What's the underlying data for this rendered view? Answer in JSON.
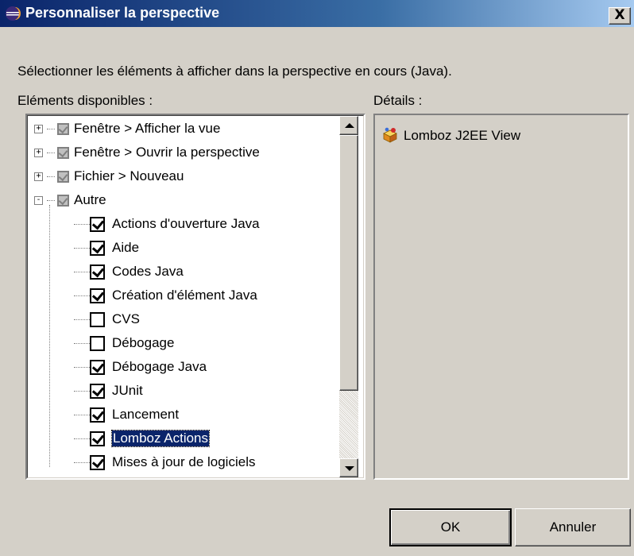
{
  "window": {
    "title": "Personnaliser la perspective",
    "close_label": "X",
    "icon": "eclipse-icon"
  },
  "description": "Sélectionner les éléments à afficher dans la perspective en cours (Java).",
  "labels": {
    "available": "Eléments disponibles :",
    "details": "Détails :"
  },
  "tree": {
    "items": [
      {
        "label": "Fenêtre > Afficher la vue",
        "checked": true,
        "grayed": true,
        "expander": "+",
        "selected": false
      },
      {
        "label": "Fenêtre > Ouvrir la perspective",
        "checked": true,
        "grayed": true,
        "expander": "+",
        "selected": false
      },
      {
        "label": "Fichier > Nouveau",
        "checked": true,
        "grayed": true,
        "expander": "+",
        "selected": false
      },
      {
        "label": "Autre",
        "checked": true,
        "grayed": true,
        "expander": "-",
        "selected": false
      },
      {
        "label": "Actions d'ouverture Java",
        "checked": true,
        "selected": false
      },
      {
        "label": "Aide",
        "checked": true,
        "selected": false
      },
      {
        "label": "Codes Java",
        "checked": true,
        "selected": false
      },
      {
        "label": "Création d'élément Java",
        "checked": true,
        "selected": false
      },
      {
        "label": "CVS",
        "checked": false,
        "selected": false
      },
      {
        "label": "Débogage",
        "checked": false,
        "selected": false
      },
      {
        "label": "Débogage Java",
        "checked": true,
        "selected": false
      },
      {
        "label": "JUnit",
        "checked": true,
        "selected": false
      },
      {
        "label": "Lancement",
        "checked": true,
        "selected": false
      },
      {
        "label": "Lomboz Actions",
        "checked": true,
        "selected": true
      },
      {
        "label": "Mises à jour de logiciels",
        "checked": true,
        "selected": false
      }
    ]
  },
  "details": {
    "items": [
      {
        "label": "Lomboz J2EE View",
        "icon": "lomboz-view-icon"
      }
    ]
  },
  "buttons": {
    "ok": "OK",
    "cancel": "Annuler"
  }
}
